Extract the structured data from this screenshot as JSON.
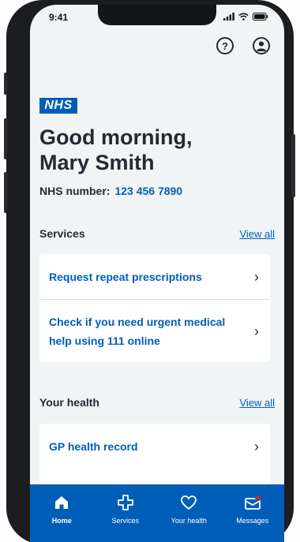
{
  "status": {
    "time": "9:41"
  },
  "header": {
    "help_glyph": "?"
  },
  "brand": {
    "logo_text": "NHS"
  },
  "greeting": {
    "line1": "Good morning,",
    "line2": "Mary Smith"
  },
  "nhs_number": {
    "label": "NHS number:",
    "value": "123 456 7890"
  },
  "services": {
    "title": "Services",
    "view_all": "View all",
    "items": [
      {
        "label": "Request repeat prescriptions"
      },
      {
        "label": "Check if you need urgent medical help using 111 online"
      }
    ]
  },
  "your_health": {
    "title": "Your health",
    "view_all": "View all",
    "items": [
      {
        "label": "GP health record"
      }
    ]
  },
  "tabbar": {
    "tabs": [
      {
        "label": "Home",
        "icon": "home-icon",
        "active": true
      },
      {
        "label": "Services",
        "icon": "plus-cross-icon"
      },
      {
        "label": "Your health",
        "icon": "heart-icon"
      },
      {
        "label": "Messages",
        "icon": "envelope-icon"
      }
    ]
  },
  "colors": {
    "nhs_blue": "#005eb8",
    "text": "#212b32",
    "background": "#f0f4f5",
    "notification": "#d5281b"
  }
}
